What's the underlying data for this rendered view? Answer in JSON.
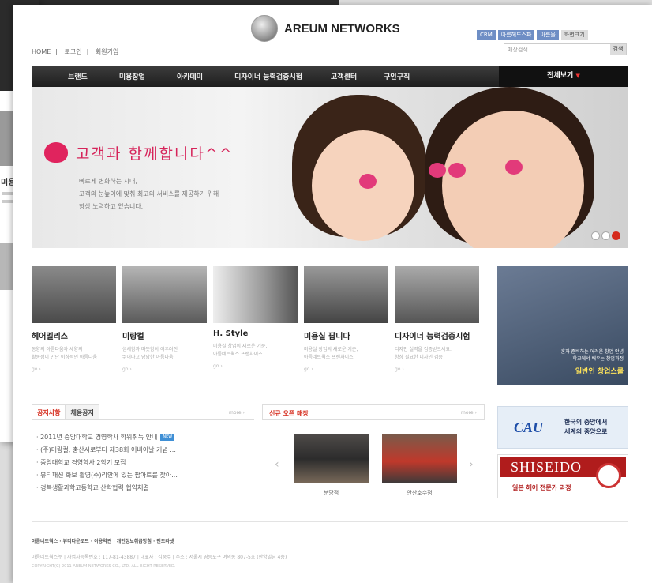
{
  "site": {
    "name": "AREUM NETWORKS"
  },
  "util": {
    "home": "HOME",
    "login": "로그인",
    "join": "회원가입"
  },
  "top_buttons": [
    "CRM",
    "아름헤드스파",
    "아름몰",
    "화면크기"
  ],
  "search": {
    "placeholder": "매장검색",
    "button": "검색"
  },
  "gnb": {
    "items": [
      "브랜드",
      "미용창업",
      "아카데미",
      "디자이너 능력검증시험",
      "고객센터",
      "구인구직"
    ],
    "all": "전체보기"
  },
  "hero": {
    "slogan": "고객과 함께합니다^^",
    "desc": [
      "빠르게 변화하는 시대,",
      "고객의 눈높이에 맞춰 최고의 서비스를 제공하기 위해",
      "항상 노력하고 있습니다."
    ],
    "slide_active": 3
  },
  "cards": [
    {
      "title": "헤어멜리스",
      "desc": "동양의 아름다움과 세양의",
      "desc2": "활동성이 만난 이상적인 아름다움",
      "go": "go ›"
    },
    {
      "title": "미랑컬",
      "desc": "섬세함과 따뜻함이 어우러진",
      "desc2": "뛰어나고 당당한 아름다움",
      "go": "go ›"
    },
    {
      "title": "H. Style",
      "desc": "미용실 창업의 새로운 기준,",
      "desc2": "아름네트웍스 프랜차이즈",
      "go": "go ›"
    },
    {
      "title": "미용실 팝니다",
      "desc": "미용실 창업의 새로운 기준,",
      "desc2": "아름네트웍스 프랜차이즈",
      "go": "go ›"
    },
    {
      "title": "디자이너 능력검증시험",
      "desc": "디자인 실력을 검증받으세요.",
      "desc2": "항상 필요한 디자인 검증",
      "go": "go ›"
    }
  ],
  "promo": {
    "small1": "혼자 준비하는 어려운 창업 안녕",
    "small2": "학교에서 배우는 창업과정",
    "big": "일반인 창업스쿨"
  },
  "notice": {
    "tab1": "공지사항",
    "tab2": "채용공지",
    "more": "more ›",
    "items": [
      "2011년 중앙대학교 경영학사 학위취득 안내",
      "(주)미랑컬, 충산시로부터 제38회 어버이날 기념 ...",
      "중앙대학교 경영학사 2학기 모집",
      "뷰티패션 화보 촬영(주)리안에 있는 팝아트를 찾아...",
      "경복생활과학고등학교 산학협력 협약체결"
    ],
    "new_label": "NEW"
  },
  "shops": {
    "title": "신규 오픈 매장",
    "more": "more ›",
    "names": [
      "분당점",
      "안산호수점"
    ]
  },
  "cau": {
    "logo": "CAU",
    "line1": "한국의 중앙에서",
    "line2": "세계의 중앙으로"
  },
  "shiseido": {
    "logo": "SHISEIDO",
    "sub": "일본 헤어 전문가 과정"
  },
  "footer": {
    "links": "아름네트웍스 · 뷰티다운로드 · 이용약관 · 개인정보취급방침 · 인트라넷",
    "info": "아름네트웍스㈜ | 사업자등록번호 : 117-81-43887 | 대표자 : 김중수 | 주소 : 서울시 영등포구 여의동 807-5호 (한양빌딩 4층)",
    "copy": "COPYRIGHT(C) 2011 AREUM NETWORKS CO., LTD. ALL RIGHT RESERVED."
  }
}
